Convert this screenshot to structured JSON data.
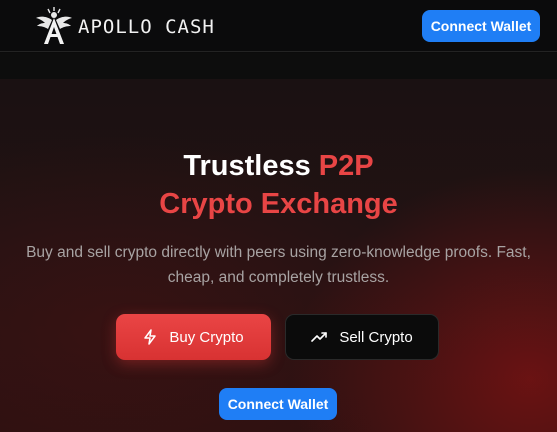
{
  "header": {
    "brand": "APOLLO CASH",
    "logo_icon": "winged-a-logo-icon",
    "connect_label": "Connect Wallet"
  },
  "hero": {
    "title_part1": "Trustless ",
    "title_accent": "P2P",
    "title_line2": "Crypto Exchange",
    "subtitle_line1": "Buy and sell crypto directly with peers using zero-knowledge proofs. Fast,",
    "subtitle_line2": "cheap, and completely trustless.",
    "buy_label": "Buy Crypto",
    "buy_icon": "lightning-icon",
    "sell_label": "Sell Crypto",
    "sell_icon": "trending-up-icon",
    "connect_label": "Connect Wallet"
  },
  "colors": {
    "accent_red": "#e84545",
    "primary_blue": "#1f7ef5",
    "background": "#0b0b0b"
  }
}
